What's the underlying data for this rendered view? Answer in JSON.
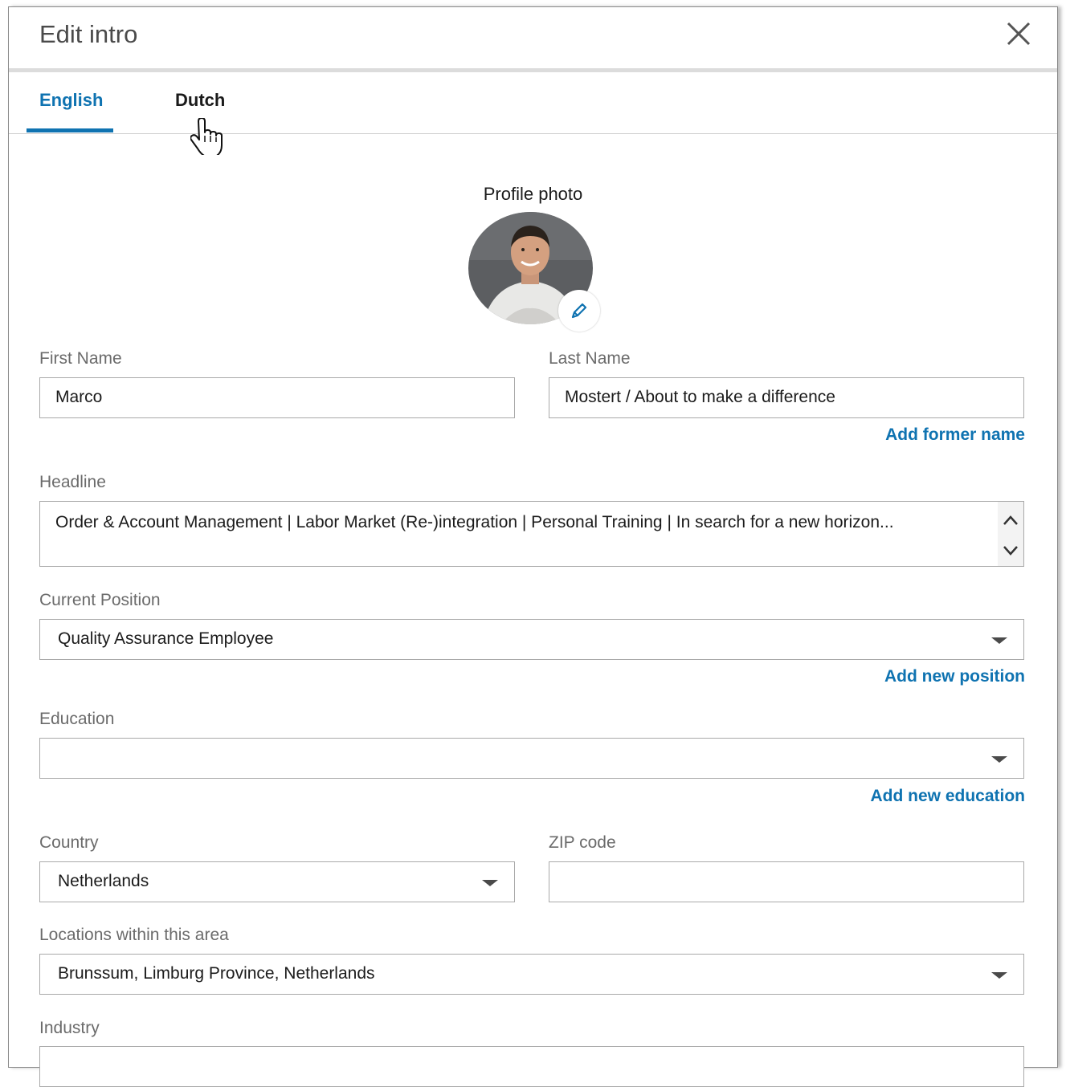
{
  "dialog": {
    "title": "Edit intro",
    "close_icon": "close-icon"
  },
  "tabs": [
    {
      "label": "English",
      "active": true
    },
    {
      "label": "Dutch",
      "active": false
    }
  ],
  "profile_photo": {
    "label": "Profile photo",
    "edit_icon": "pencil-icon"
  },
  "fields": {
    "first_name": {
      "label": "First Name",
      "value": "Marco"
    },
    "last_name": {
      "label": "Last Name",
      "value": "Mostert / About to make a difference"
    },
    "add_former_name": "Add former name",
    "headline": {
      "label": "Headline",
      "value": "Order & Account Management | Labor Market (Re-)integration | Personal Training | In search for a new horizon..."
    },
    "current_position": {
      "label": "Current Position",
      "value": "Quality Assurance Employee"
    },
    "add_new_position": "Add new position",
    "education": {
      "label": "Education",
      "value": ""
    },
    "add_new_education": "Add new education",
    "country": {
      "label": "Country",
      "value": "Netherlands"
    },
    "zip_code": {
      "label": "ZIP code",
      "value": ""
    },
    "locations": {
      "label": "Locations within this area",
      "value": "Brunssum, Limburg Province, Netherlands"
    },
    "industry": {
      "label": "Industry"
    }
  },
  "colors": {
    "accent": "#0f73b1",
    "border": "#a9a9a9",
    "label": "#6b6b6b"
  }
}
